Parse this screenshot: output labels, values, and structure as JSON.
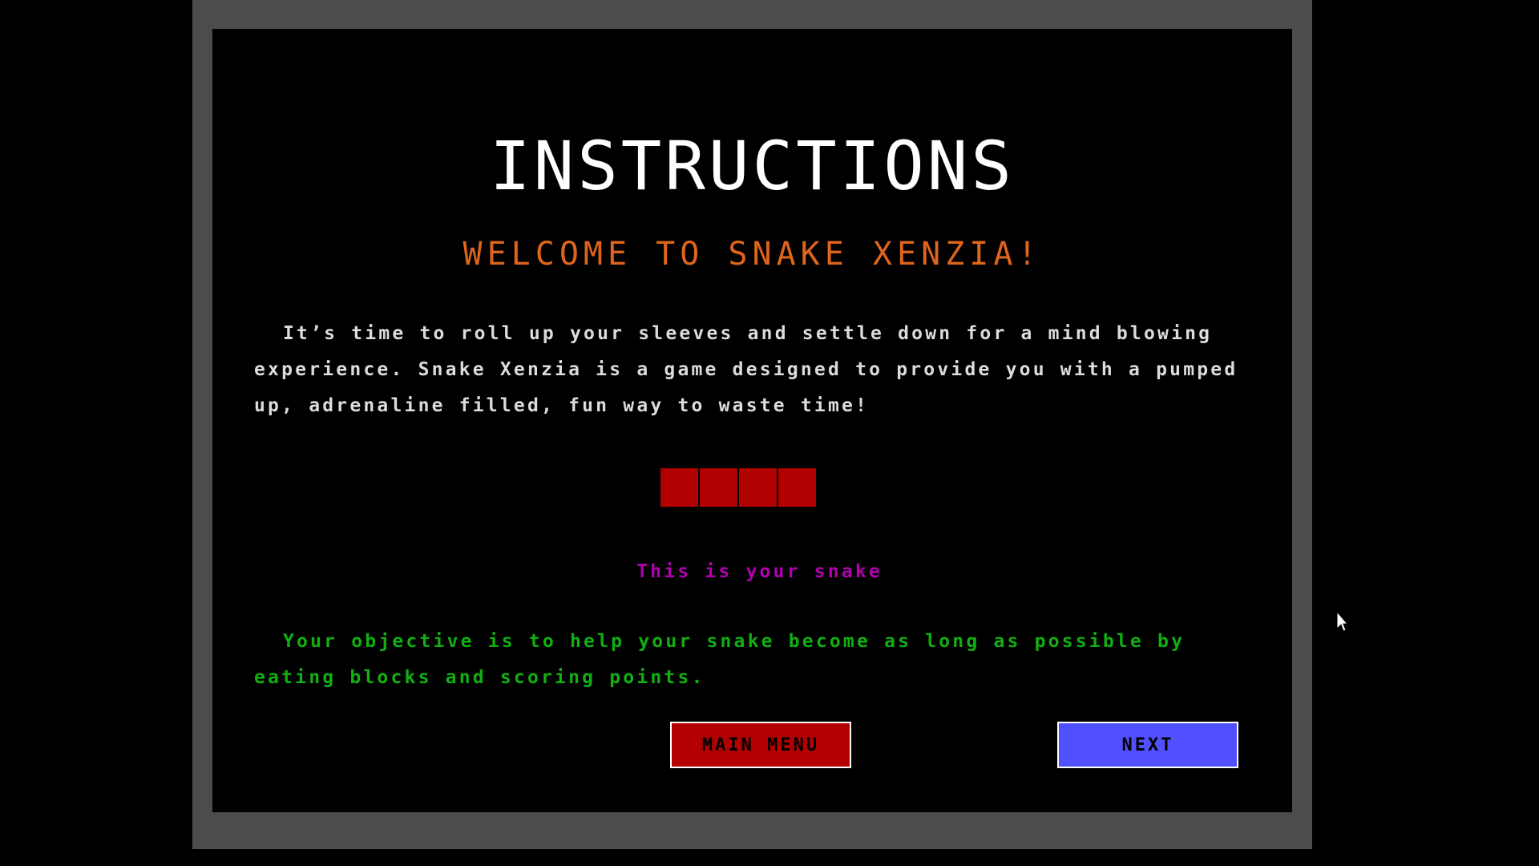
{
  "title": "INSTRUCTIONS",
  "welcome": "WELCOME TO SNAKE XENZIA!",
  "intro": "It’s time to roll up your sleeves and settle down for a mind blowing experience. Snake Xenzia is a game designed to provide you with a pumped up, adrenaline filled, fun way to waste time!",
  "snake": {
    "segments": 4,
    "color": "#b00000",
    "caption": "This is your snake"
  },
  "objective": "Your objective is to help your snake become as long as possible by eating blocks and scoring points.",
  "buttons": {
    "main_menu": "MAIN MENU",
    "next": "NEXT"
  },
  "colors": {
    "background": "#000000",
    "frame": "#4c4c4c",
    "title": "#ffffff",
    "welcome": "#e0651c",
    "intro_text": "#dcdcdc",
    "caption": "#b000b0",
    "objective_text": "#10b010",
    "main_menu_button": "#b30000",
    "next_button": "#5050ff"
  },
  "icons": {
    "cursor": "arrow-cursor-icon"
  }
}
